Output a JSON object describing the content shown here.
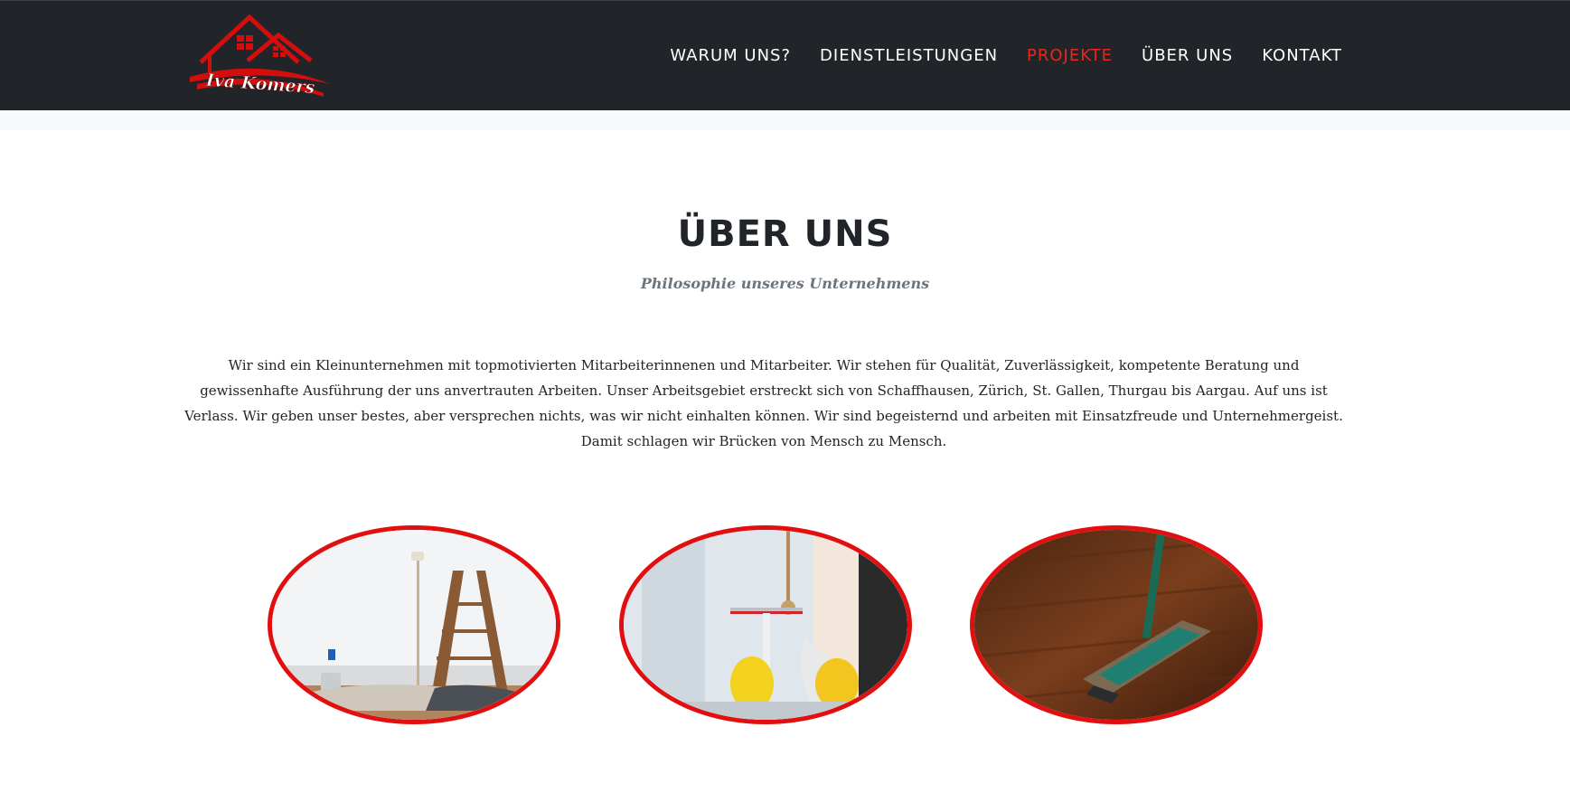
{
  "header": {
    "logo_text": "Iva Komers",
    "nav": [
      {
        "label": "WARUM UNS?",
        "active": false
      },
      {
        "label": "DIENSTLEISTUNGEN",
        "active": false
      },
      {
        "label": "PROJEKTE",
        "active": true
      },
      {
        "label": "ÜBER UNS",
        "active": false
      },
      {
        "label": "KONTAKT",
        "active": false
      }
    ]
  },
  "about": {
    "title": "ÜBER UNS",
    "subtitle": "Philosophie unseres Unternehmens",
    "text": "Wir sind ein Kleinunternehmen mit topmotivierten Mitarbeiterinnenen und Mitarbeiter. Wir stehen für Qualität, Zuverlässigkeit, kompetente Beratung und gewissenhafte Ausführung der uns anvertrauten Arbeiten. Unser Arbeitsgebiet erstreckt sich von Schaffhausen, Zürich, St. Gallen, Thurgau bis Aargau. Auf uns ist Verlass. Wir geben unser bestes, aber versprechen nichts, was wir nicht einhalten können. Wir sind begeisternd und arbeiten mit Einsatzfreude und Unternehmergeist. Damit schlagen wir Brücken von Mensch zu Mensch."
  },
  "photos": [
    {
      "name": "painting-room-photo"
    },
    {
      "name": "window-cleaning-photo"
    },
    {
      "name": "floor-mop-photo"
    }
  ],
  "colors": {
    "navbar": "#212529",
    "accent": "#e8261c",
    "photo_border": "#e10f0f"
  }
}
